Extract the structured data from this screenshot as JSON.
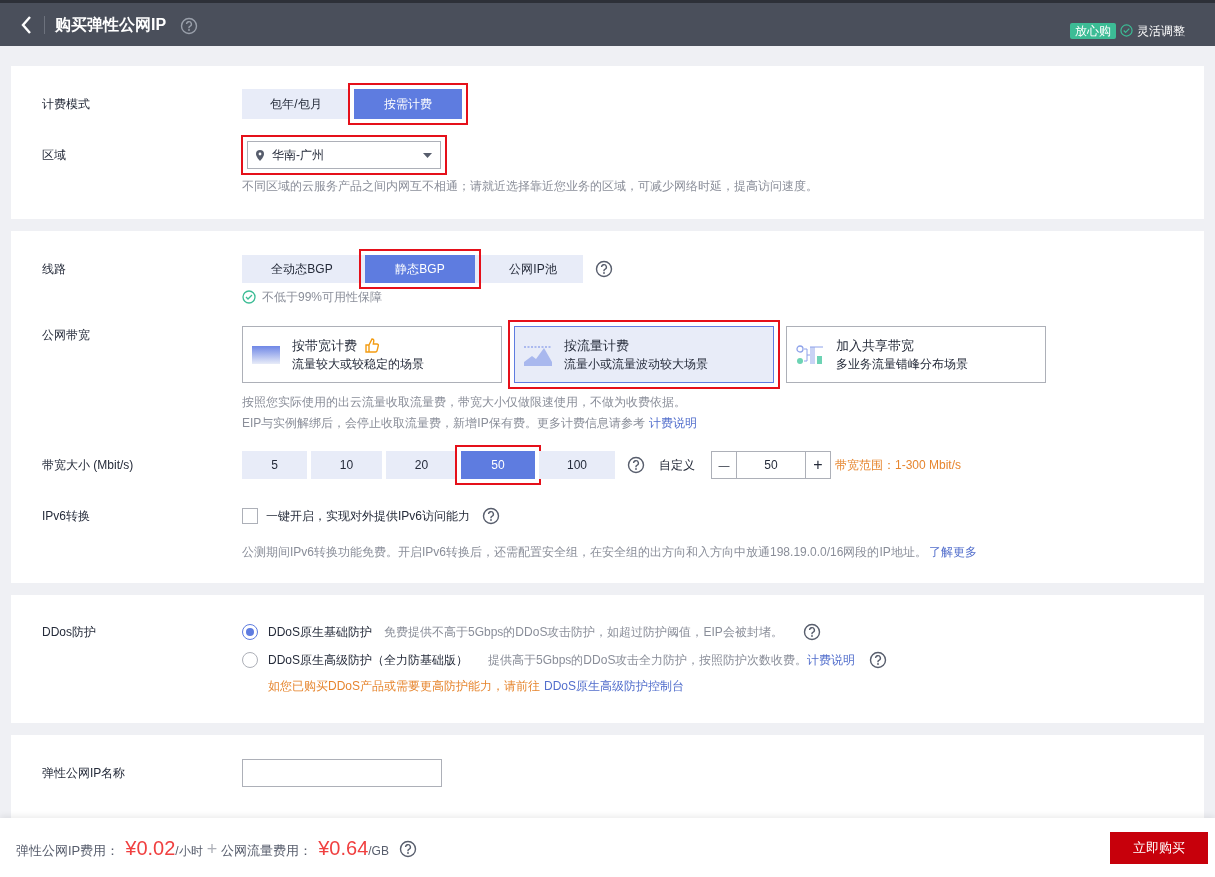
{
  "header": {
    "title": "购买弹性公网IP",
    "badge": "放心购",
    "feature": "灵活调整"
  },
  "billing": {
    "label": "计费模式",
    "options": [
      {
        "label": "包年/包月",
        "selected": false,
        "highlighted": false
      },
      {
        "label": "按需计费",
        "selected": true,
        "highlighted": true
      }
    ]
  },
  "region": {
    "label": "区域",
    "value": "华南-广州",
    "highlighted": true,
    "hint": "不同区域的云服务产品之间内网互不相通；请就近选择靠近您业务的区域，可减少网络时延，提高访问速度。"
  },
  "line": {
    "label": "线路",
    "options": [
      {
        "label": "全动态BGP",
        "selected": false,
        "highlighted": false
      },
      {
        "label": "静态BGP",
        "selected": true,
        "highlighted": true
      },
      {
        "label": "公网IP池",
        "selected": false,
        "highlighted": false
      }
    ],
    "guarantee": "不低于99%可用性保障"
  },
  "bandwidth_type": {
    "label": "公网带宽",
    "options": [
      {
        "kind": "bandwidth",
        "title": "按带宽计费",
        "subtitle": "流量较大或较稳定的场景",
        "recommended": true,
        "selected": false,
        "highlighted": false
      },
      {
        "kind": "traffic",
        "title": "按流量计费",
        "subtitle": "流量小或流量波动较大场景",
        "recommended": false,
        "selected": true,
        "highlighted": true
      },
      {
        "kind": "shared",
        "title": "加入共享带宽",
        "subtitle": "多业务流量错峰分布场景",
        "recommended": false,
        "selected": false,
        "highlighted": false
      }
    ],
    "note": "按照您实际使用的出云流量收取流量费，带宽大小仅做限速使用，不做为收费依据。",
    "note_2": "EIP与实例解绑后，会停止收取流量费，新增IP保有费。更多计费信息请参考",
    "link": "计费说明"
  },
  "bandwidth_size": {
    "label": "带宽大小 (Mbit/s)",
    "options": [
      {
        "label": "5",
        "selected": false,
        "highlighted": false
      },
      {
        "label": "10",
        "selected": false,
        "highlighted": false
      },
      {
        "label": "20",
        "selected": false,
        "highlighted": false
      },
      {
        "label": "50",
        "selected": true,
        "highlighted": true
      },
      {
        "label": "100",
        "selected": false,
        "highlighted": false
      }
    ],
    "custom_label": "自定义",
    "minus": "—",
    "custom_value": "50",
    "plus": "+",
    "range": "带宽范围：1-300 Mbit/s"
  },
  "ipv6": {
    "label": "IPv6转换",
    "checked": false,
    "option": "一键开启，实现对外提供IPv6访问能力",
    "note": "公测期间IPv6转换功能免费。开启IPv6转换后，还需配置安全组，在安全组的出方向和入方向中放通198.19.0.0/16网段的IP地址。",
    "link": "了解更多"
  },
  "ddos": {
    "label": "DDos防护",
    "options": [
      {
        "name": "DDoS原生基础防护",
        "description": "免费提供不高于5Gbps的DDoS攻击防护，如超过防护阈值，EIP会被封堵。",
        "selected": true
      },
      {
        "name": "DDoS原生高级防护（全力防基础版）",
        "description": "提供高于5Gbps的DDoS攻击全力防护，按照防护次数收费。",
        "link": "计费说明",
        "selected": false
      }
    ],
    "notice": "如您已购买DDoS产品或需要更高防护能力，请前往",
    "notice_link": "DDoS原生高级防护控制台"
  },
  "eip_name": {
    "label": "弹性公网IP名称"
  },
  "footer": {
    "ip_fee_label": "弹性公网IP费用：",
    "ip_fee": "¥0.02",
    "ip_fee_unit": "/小时",
    "plus": "+",
    "traffic_fee_label": "公网流量费用：",
    "traffic_fee": "¥0.64",
    "traffic_fee_unit": "/GB",
    "buy_button": "立即购买"
  }
}
